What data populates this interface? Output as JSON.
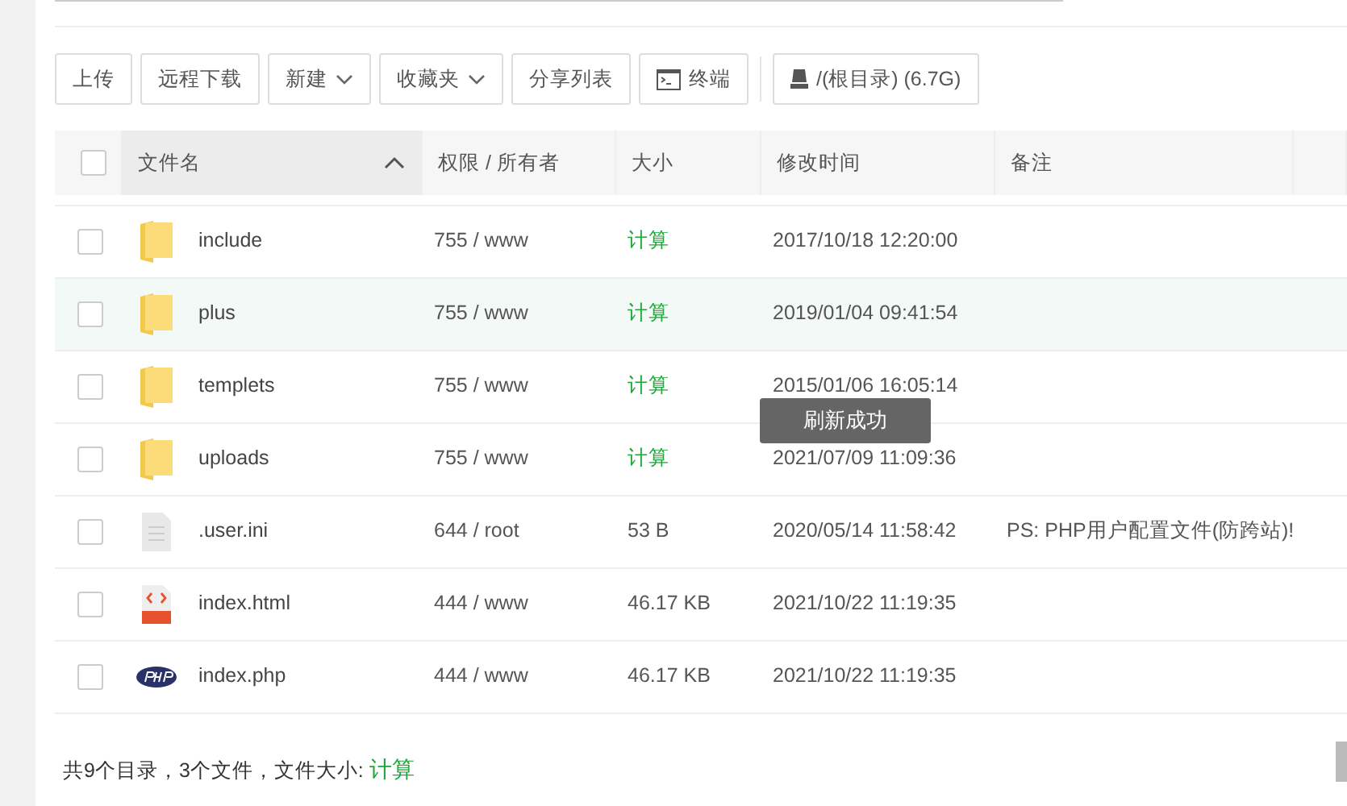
{
  "toolbar": [
    {
      "label": "上传",
      "kind": "plain",
      "dropdown": false
    },
    {
      "label": "远程下载",
      "kind": "plain",
      "dropdown": false
    },
    {
      "label": "新建",
      "kind": "plain",
      "dropdown": true
    },
    {
      "label": "收藏夹",
      "kind": "plain",
      "dropdown": true
    },
    {
      "label": "分享列表",
      "kind": "plain",
      "dropdown": false
    },
    {
      "label": "终端",
      "kind": "terminal",
      "dropdown": false
    },
    {
      "label": "/(根目录) (6.7G)",
      "kind": "disk",
      "dropdown": false
    }
  ],
  "table": {
    "select_all": {
      "checked": false
    },
    "columns": [
      {
        "label": "文件名",
        "sorted": true
      },
      {
        "label": "权限 / 所有者",
        "sorted": false
      },
      {
        "label": "大小",
        "sorted": false
      },
      {
        "label": "修改时间",
        "sorted": false
      },
      {
        "label": "备注",
        "sorted": false
      }
    ],
    "rows": [
      {
        "kind": "folder",
        "checked": false,
        "highlighted": false,
        "name": "include",
        "perm": "755 / www",
        "size": "计算",
        "size_link": true,
        "mtime": "2017/10/18 12:20:00"
      },
      {
        "kind": "folder",
        "checked": false,
        "highlighted": true,
        "name": "plus",
        "perm": "755 / www",
        "size": "计算",
        "size_link": true,
        "mtime": "2019/01/04 09:41:54"
      },
      {
        "kind": "folder",
        "checked": false,
        "highlighted": false,
        "name": "templets",
        "perm": "755 / www",
        "size": "计算",
        "size_link": true,
        "mtime": "2015/01/06 16:05:14"
      },
      {
        "kind": "folder",
        "checked": false,
        "highlighted": false,
        "name": "uploads",
        "perm": "755 / www",
        "size": "计算",
        "size_link": true,
        "mtime": "2021/07/09 11:09:36"
      },
      {
        "kind": "text",
        "checked": false,
        "highlighted": false,
        "name": ".user.ini",
        "perm": "644 / root",
        "size": "53 B",
        "size_link": false,
        "mtime": "2020/05/14 11:58:42",
        "note": "PS: PHP用户配置文件(防跨站)!"
      },
      {
        "kind": "html",
        "checked": false,
        "highlighted": false,
        "name": "index.html",
        "perm": "444 / www",
        "size": "46.17 KB",
        "size_link": false,
        "mtime": "2021/10/22 11:19:35"
      },
      {
        "kind": "php",
        "checked": false,
        "highlighted": false,
        "name": "index.php",
        "perm": "444 / www",
        "size": "46.17 KB",
        "size_link": false,
        "mtime": "2021/10/22 11:19:35"
      }
    ]
  },
  "footer": {
    "summary": "共9个目录，3个文件，文件大小: ",
    "link": "计算"
  },
  "toast": "刷新成功"
}
